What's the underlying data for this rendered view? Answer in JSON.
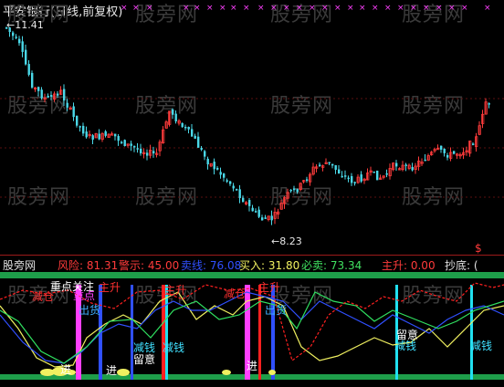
{
  "title": "平安银行(日线,前复权)",
  "watermark": "股旁网",
  "price_max_label": "11.41",
  "price_min_label": "8.23",
  "dollar_marker": "$",
  "indicator": {
    "name": "股旁网",
    "fengxian": "风险: 81.31",
    "jingshi": "警示: 45.00",
    "maixian": "卖线: 76.08",
    "mairu": "买入: 31.80",
    "bimai": "必卖: 73.34",
    "zhusheng": "主升: 0.00",
    "chaodi": "抄底: ("
  },
  "annotations": {
    "zhongdian": "重点关注",
    "jiancang1": "减仓",
    "jiancang2": "减仓",
    "zhusheng1": "主升",
    "zhusheng2": "主升",
    "zhusheng3": "主升",
    "chuhuo1": "出货",
    "chuhuo2": "出货",
    "jianxian1": "减钱",
    "jianxian2": "减钱",
    "jianxian3": "减钱",
    "jianxian4": "减钱",
    "liuyi1": "留意",
    "liuyi2": "留意",
    "jin1": "进",
    "jin2": "进",
    "jin3": "进",
    "zhongdian2": "重点"
  },
  "colors": {
    "up": "#ff3b3b",
    "down": "#4ad8e8",
    "magenta": "#ff40ff",
    "green_band": "#1e9e4a",
    "yellow": "#f0f060",
    "blue": "#3050ff",
    "cyan": "#20e0f0",
    "red": "#ff2020"
  }
}
